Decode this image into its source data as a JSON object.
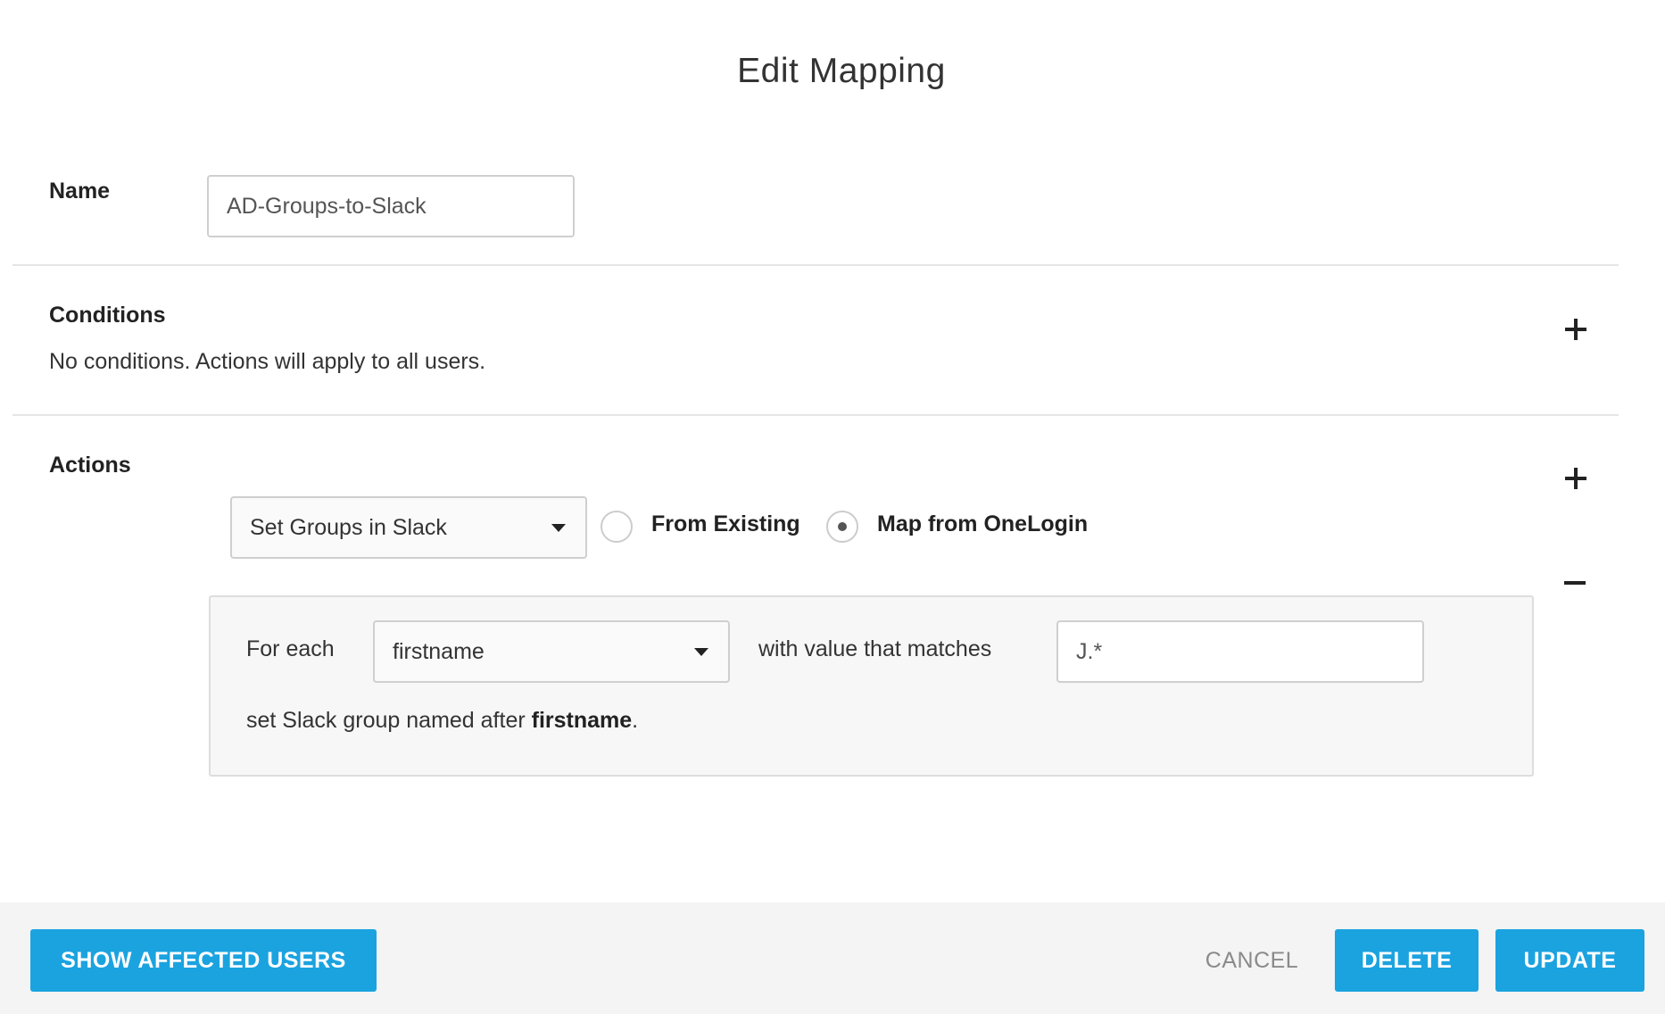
{
  "dialog": {
    "title": "Edit Mapping"
  },
  "name_section": {
    "label": "Name",
    "value": "AD-Groups-to-Slack"
  },
  "conditions": {
    "label": "Conditions",
    "empty_text": "No conditions. Actions will apply to all users.",
    "add_icon": "plus-icon"
  },
  "actions": {
    "label": "Actions",
    "add_icon": "plus-icon",
    "remove_icon": "minus-icon",
    "action_select": "Set Groups in Slack",
    "radio_options": [
      {
        "label": "From Existing",
        "selected": false
      },
      {
        "label": "Map from OneLogin",
        "selected": true
      }
    ],
    "mapping": {
      "for_each_label": "For each",
      "field_select": "firstname",
      "matches_label": "with value that matches",
      "pattern_value": "J.*",
      "result_prefix": "set Slack group named after",
      "result_field": "firstname",
      "result_suffix": "."
    }
  },
  "footer": {
    "show_affected": "SHOW AFFECTED USERS",
    "cancel": "CANCEL",
    "delete": "DELETE",
    "update": "UPDATE"
  },
  "colors": {
    "primary": "#1ba3e0",
    "footer_bg": "#f4f4f4",
    "cancel_text": "#8a8a8a"
  }
}
